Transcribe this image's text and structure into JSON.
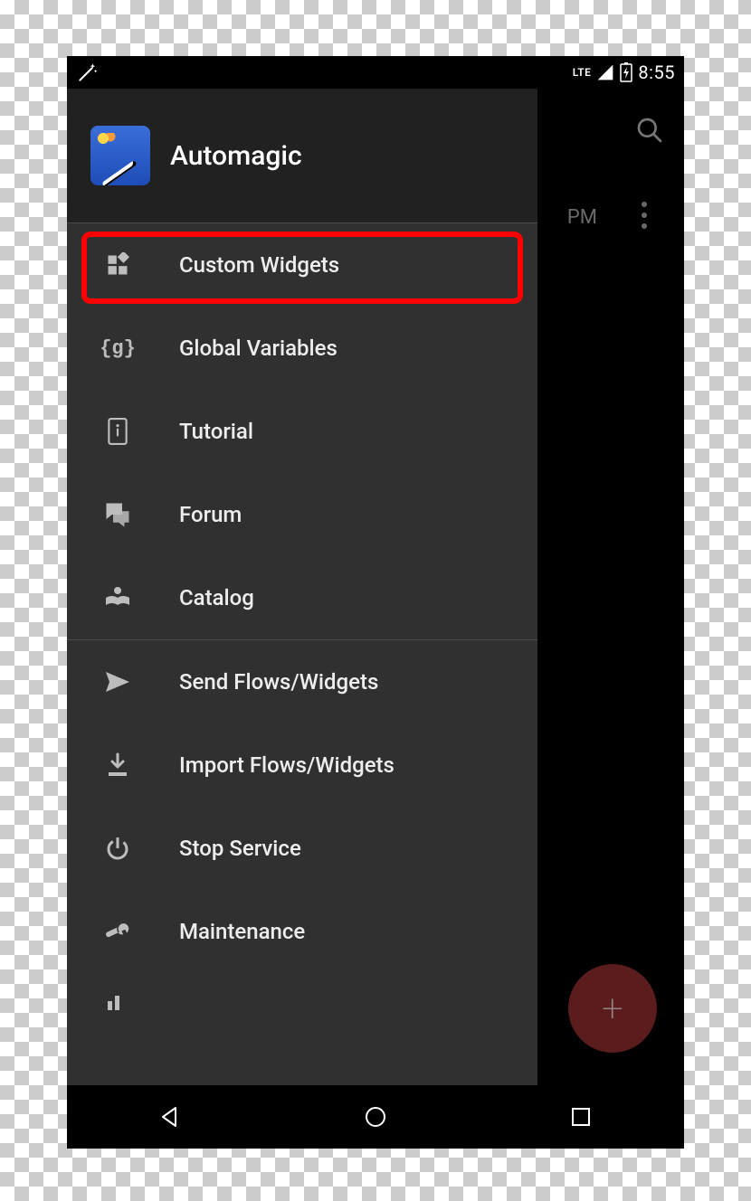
{
  "status": {
    "time": "8:55",
    "network_label": "LTE"
  },
  "background": {
    "visible_time_fragment": "PM"
  },
  "drawer": {
    "title": "Automagic",
    "items": [
      {
        "icon": "widgets-icon",
        "label": "Custom Widgets",
        "highlighted": true
      },
      {
        "icon": "globals-icon",
        "label": "Global Variables"
      },
      {
        "icon": "tutorial-icon",
        "label": "Tutorial"
      },
      {
        "icon": "forum-icon",
        "label": "Forum"
      },
      {
        "icon": "catalog-icon",
        "label": "Catalog"
      }
    ],
    "items2": [
      {
        "icon": "send-icon",
        "label": "Send Flows/Widgets"
      },
      {
        "icon": "import-icon",
        "label": "Import Flows/Widgets"
      },
      {
        "icon": "power-icon",
        "label": "Stop Service"
      },
      {
        "icon": "wrench-icon",
        "label": "Maintenance"
      }
    ],
    "truncated_icon": "stats-icon"
  },
  "fab": {
    "glyph": "+"
  }
}
